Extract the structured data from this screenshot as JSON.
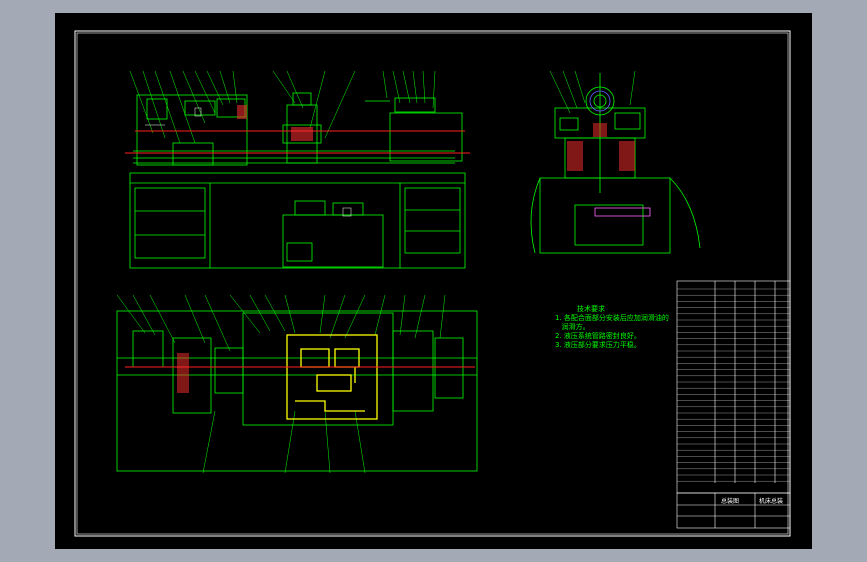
{
  "colors": {
    "background": "#a3aab5",
    "sheet": "#000000",
    "frame": "#ffffff",
    "geometry": "#00ff00",
    "centerline": "#ff2020",
    "highlight": "#ffff00",
    "section": "#ff3030",
    "accent_blue": "#6060ff",
    "dimension": "#ffffff"
  },
  "tech_requirements": {
    "title": "技术要求",
    "lines": [
      "1. 各配合面部分安装后应加润滑油的",
      "   润滑方。",
      "2. 液压系统管路密封良好。",
      "3. 液压部分要求压力平稳。"
    ]
  },
  "title_block": {
    "drawing_name": "总装图",
    "company": "机床总装"
  }
}
